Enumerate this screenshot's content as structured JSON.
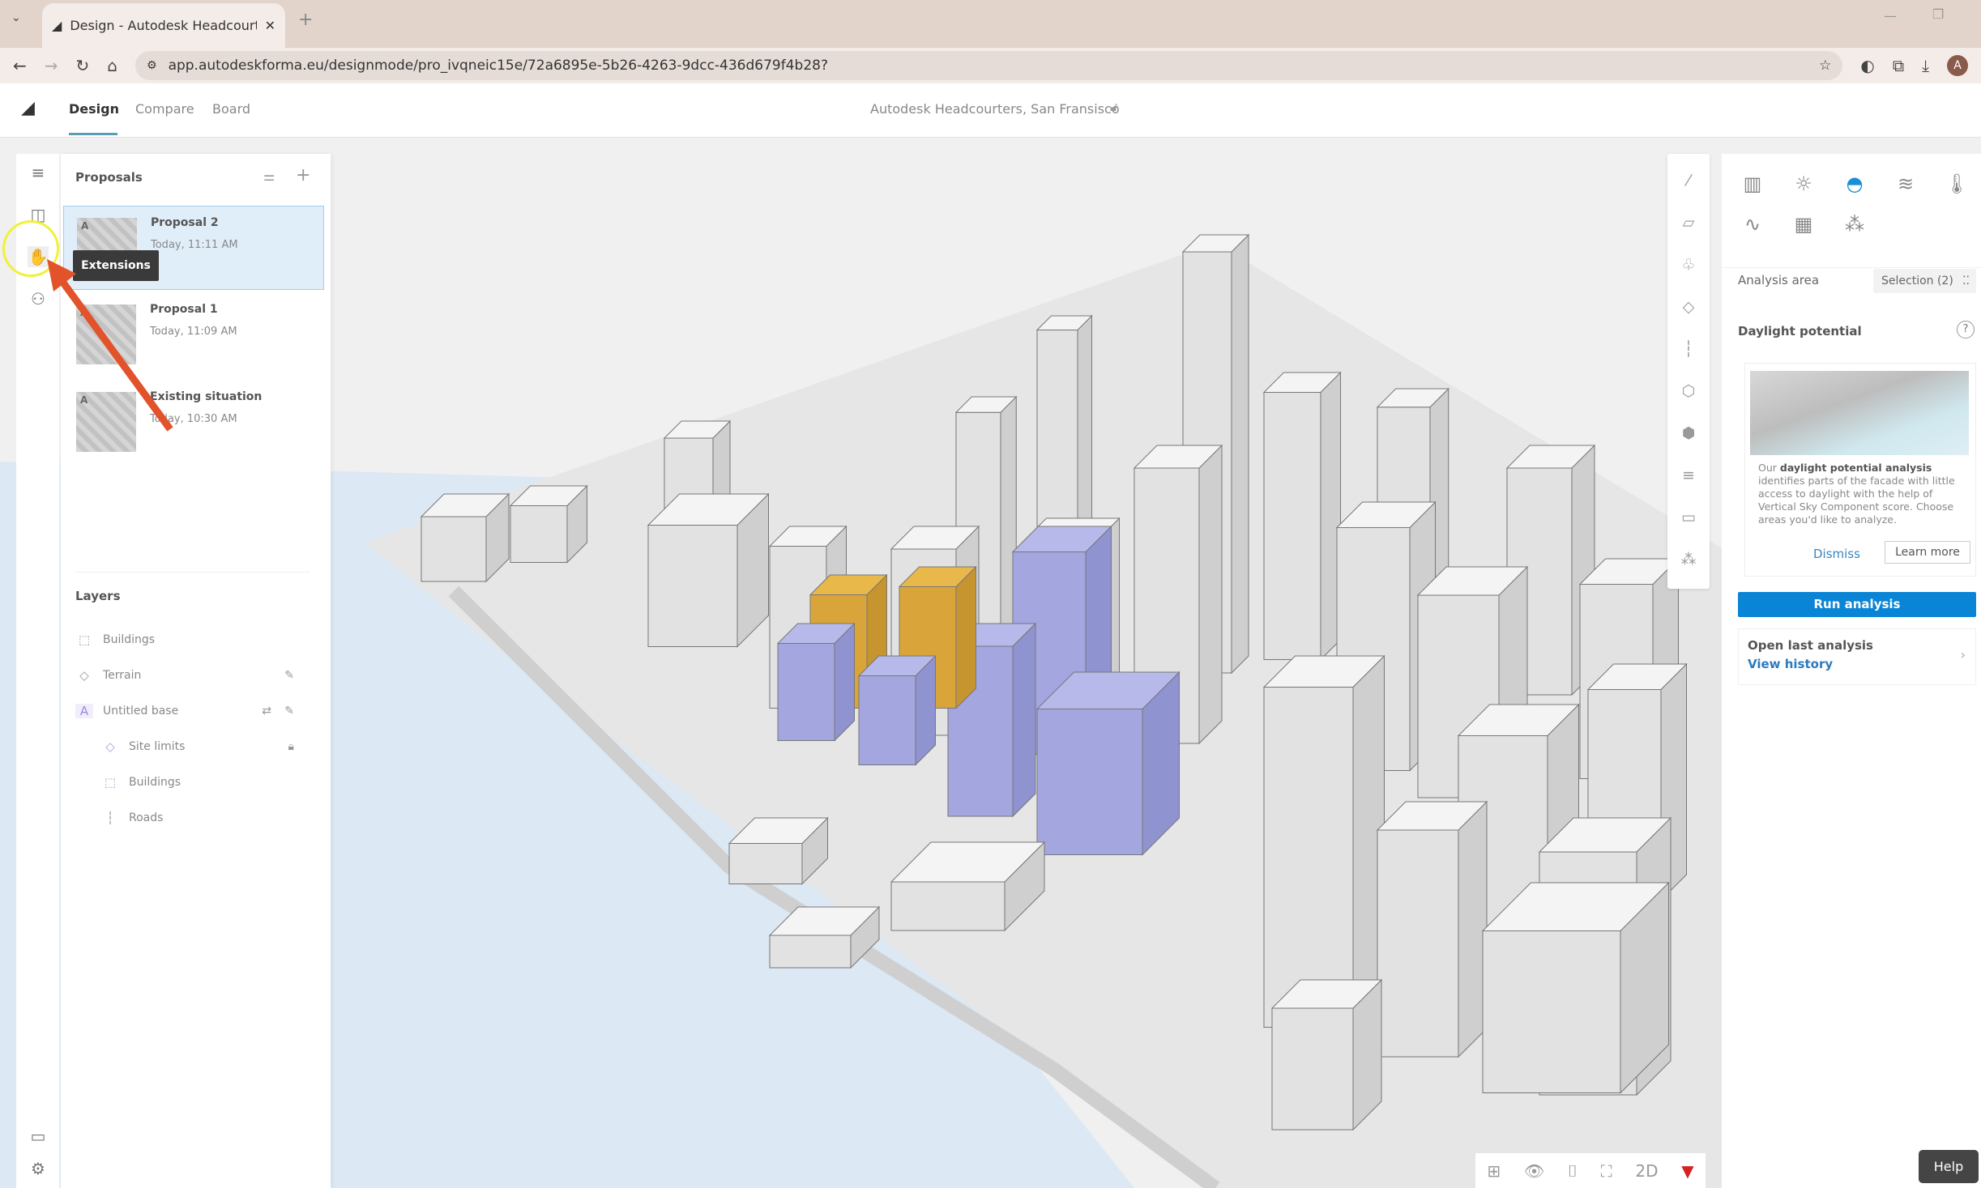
{
  "browser": {
    "tab_title": "Design - Autodesk Headcourters",
    "url": "app.autodeskforma.eu/designmode/pro_ivqneic15e/72a6895e-5b26-4263-9dcc-436d679f4b28?",
    "profile_initial": "A"
  },
  "app": {
    "tabs": [
      {
        "label": "Design",
        "active": true
      },
      {
        "label": "Compare"
      },
      {
        "label": "Board"
      }
    ],
    "project_title": "Autodesk Headcourters, San Fransisco"
  },
  "rail": {
    "tooltip": "Extensions"
  },
  "proposals": {
    "title": "Proposals",
    "items": [
      {
        "name": "Proposal 2",
        "time": "Today, 11:11 AM",
        "badge": "A",
        "selected": true
      },
      {
        "name": "Proposal 1",
        "time": "Today, 11:09 AM",
        "badge": "A"
      },
      {
        "name": "Existing situation",
        "time": "Today, 10:30 AM",
        "badge": "A"
      }
    ]
  },
  "layers": {
    "title": "Layers",
    "items": [
      {
        "label": "Buildings",
        "icon": "buildings-icon"
      },
      {
        "label": "Terrain",
        "icon": "terrain-icon"
      },
      {
        "label": "Untitled base",
        "icon": "A"
      },
      {
        "label": "Site limits",
        "icon": "site-limits-icon"
      },
      {
        "label": "Buildings",
        "icon": "buildings-icon"
      },
      {
        "label": "Roads",
        "icon": "roads-icon"
      }
    ]
  },
  "analysis": {
    "area_label": "Analysis area",
    "area_value": "Selection (2)",
    "section_title": "Daylight potential",
    "card_prefix": "Our ",
    "card_bold": "daylight potential analysis",
    "card_text": " identifies parts of the facade with little access to daylight with the help of Vertical Sky Component score. Choose areas you'd like to analyze.",
    "dismiss": "Dismiss",
    "learn_more": "Learn more",
    "run": "Run analysis",
    "open_last": "Open last analysis",
    "view_history": "View history"
  },
  "bottom_toolbar": {
    "mode_2d": "2D"
  },
  "help": "Help",
  "colors": {
    "accent": "#0a85d6",
    "highlight": "#e8b84a",
    "selected_building": "#b7b9ea",
    "arrow": "#e2522b"
  }
}
